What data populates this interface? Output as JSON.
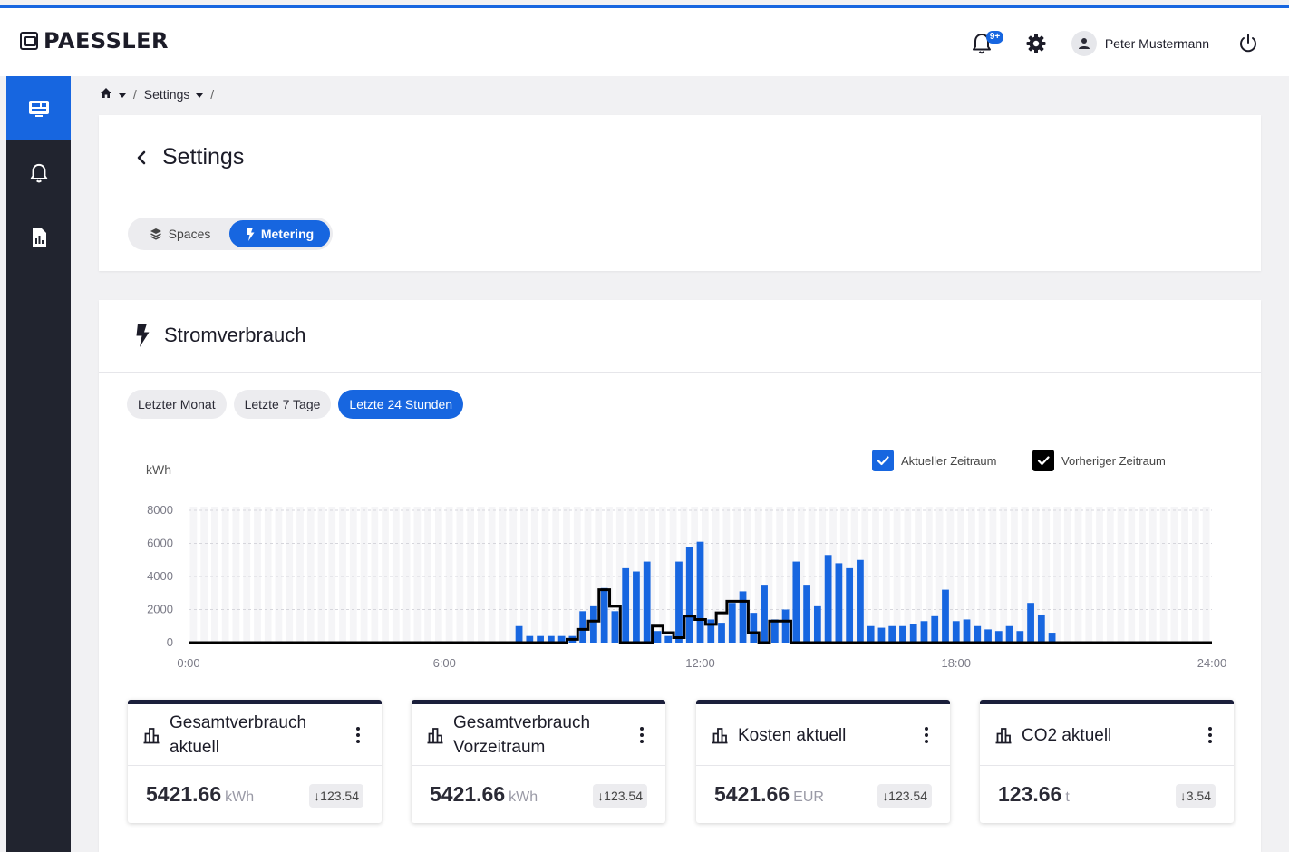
{
  "app": {
    "logo_text": "PAESSLER",
    "notification_badge": "9+",
    "user_name": "Peter Mustermann"
  },
  "sidebar": {
    "items": [
      {
        "icon": "dashboard-icon",
        "active": true
      },
      {
        "icon": "bell-icon",
        "active": false
      },
      {
        "icon": "report-icon",
        "active": false
      }
    ]
  },
  "breadcrumb": {
    "current": "Settings",
    "separator": "/"
  },
  "settings": {
    "title": "Settings",
    "tabs": [
      {
        "label": "Spaces",
        "active": false
      },
      {
        "label": "Metering",
        "active": true
      }
    ]
  },
  "chart_card": {
    "title": "Stromverbrauch",
    "ranges": [
      {
        "label": "Letzter Monat",
        "active": false
      },
      {
        "label": "Letzte 7 Tage",
        "active": false
      },
      {
        "label": "Letzte 24 Stunden",
        "active": true
      }
    ],
    "legend": {
      "current": "Aktueller Zeitraum",
      "previous": "Vorheriger Zeitraum"
    }
  },
  "colors": {
    "accent": "#1766e0",
    "sidebar": "#21242f",
    "previous_line": "#000000"
  },
  "chart_data": {
    "type": "bar",
    "ylabel": "kWh",
    "ylim": [
      0,
      8000
    ],
    "yticks": [
      0,
      2000,
      4000,
      6000,
      8000
    ],
    "xlim": [
      0,
      24
    ],
    "xtick_labels": [
      "0:00",
      "6:00",
      "12:00",
      "18:00",
      "24:00"
    ],
    "grid": true,
    "series": [
      {
        "name": "Aktueller Zeitraum",
        "kind": "bar",
        "x_hours": [
          7.75,
          8.0,
          8.25,
          8.5,
          8.75,
          9.0,
          9.25,
          9.5,
          9.75,
          10.0,
          10.25,
          10.5,
          10.75,
          11.0,
          11.25,
          11.5,
          11.75,
          12.0,
          12.25,
          12.5,
          12.75,
          13.0,
          13.25,
          13.5,
          13.75,
          14.0,
          14.25,
          14.5,
          14.75,
          15.0,
          15.25,
          15.5,
          15.75,
          16.0,
          16.25,
          16.5,
          16.75,
          17.0,
          17.25,
          17.5,
          17.75,
          18.0,
          18.25,
          18.5,
          18.75,
          19.0,
          19.25,
          19.5,
          19.75,
          20.0,
          20.25,
          20.5,
          20.75
        ],
        "values": [
          1000,
          400,
          400,
          400,
          400,
          400,
          1900,
          2200,
          3300,
          1900,
          4500,
          4300,
          4900,
          700,
          400,
          4900,
          5800,
          6100,
          1400,
          1200,
          2400,
          3100,
          1800,
          3500,
          1400,
          2000,
          4900,
          3500,
          2200,
          5300,
          4800,
          4500,
          5000,
          1000,
          900,
          1000,
          1000,
          1100,
          1300,
          1600,
          3200,
          1300,
          1400,
          1000,
          800,
          700,
          1000,
          700,
          2400,
          1700,
          600,
          0,
          0
        ],
        "color": "#1766e0"
      },
      {
        "name": "Vorheriger Zeitraum",
        "kind": "step",
        "x_hours": [
          9.0,
          9.25,
          9.5,
          9.75,
          10.0,
          10.25,
          10.5,
          10.75,
          11.0,
          11.25,
          11.5,
          11.75,
          12.0,
          12.25,
          12.5,
          12.75,
          13.0,
          13.25,
          13.5,
          13.75,
          14.0,
          14.25,
          14.5
        ],
        "values": [
          200,
          800,
          1300,
          3200,
          2200,
          0,
          0,
          0,
          1000,
          600,
          300,
          1600,
          1400,
          1100,
          1800,
          2500,
          2500,
          600,
          0,
          1300,
          1300,
          0,
          0
        ],
        "color": "#000000"
      }
    ]
  },
  "kpis": [
    {
      "title": "Gesamtverbrauch aktuell",
      "value": "5421.66",
      "unit": "kWh",
      "delta": "123.54"
    },
    {
      "title": "Gesamtverbrauch Vorzeitraum",
      "value": "5421.66",
      "unit": "kWh",
      "delta": "123.54"
    },
    {
      "title": "Kosten aktuell",
      "value": "5421.66",
      "unit": "EUR",
      "delta": "123.54"
    },
    {
      "title": "CO2 aktuell",
      "value": "123.66",
      "unit": "t",
      "delta": "3.54"
    }
  ]
}
